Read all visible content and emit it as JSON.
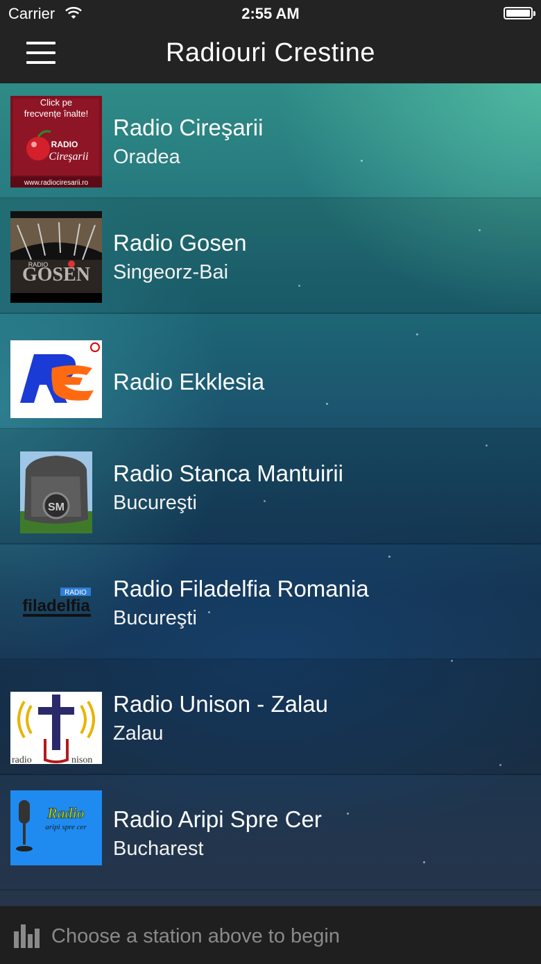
{
  "status_bar": {
    "carrier": "Carrier",
    "time": "2:55 AM"
  },
  "nav": {
    "title": "Radiouri Crestine"
  },
  "stations": [
    {
      "name": "Radio Cireşarii",
      "city": "Oradea",
      "logo_caption": "www.radiociresarii.ro"
    },
    {
      "name": "Radio Gosen",
      "city": "Singeorz-Bai"
    },
    {
      "name": "Radio Ekklesia",
      "city": ""
    },
    {
      "name": "Radio Stanca Mantuirii",
      "city": "Bucureşti"
    },
    {
      "name": "Radio Filadelfia Romania",
      "city": "Bucureşti"
    },
    {
      "name": "Radio Unison - Zalau",
      "city": "Zalau"
    },
    {
      "name": "Radio Aripi Spre Cer",
      "city": "Bucharest"
    }
  ],
  "player": {
    "prompt": "Choose a station above to begin"
  },
  "colors": {
    "bar_bg": "#232323",
    "player_bg": "#1f1f1f",
    "player_text": "#8a8a8a"
  }
}
